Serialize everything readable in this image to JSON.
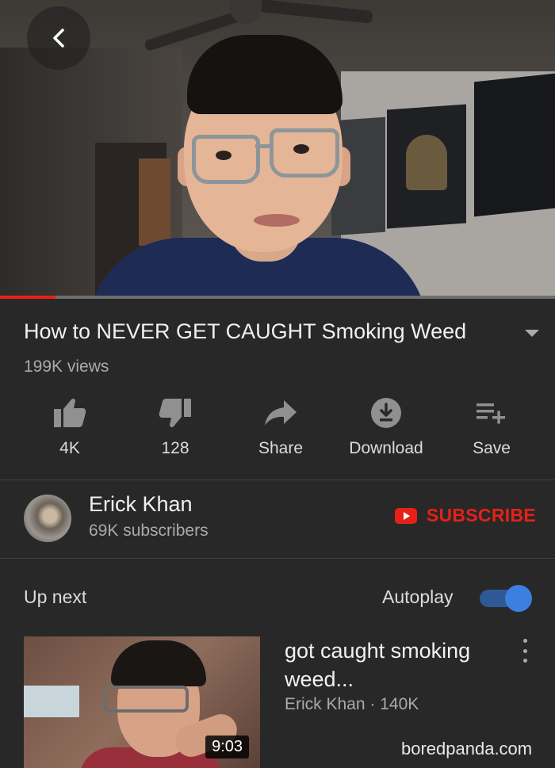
{
  "video": {
    "title": "How to NEVER GET CAUGHT Smoking Weed",
    "views": "199K views",
    "progress": 0.1
  },
  "actions": [
    {
      "icon": "thumbs-up-icon",
      "label": "4K"
    },
    {
      "icon": "thumbs-down-icon",
      "label": "128"
    },
    {
      "icon": "share-icon",
      "label": "Share"
    },
    {
      "icon": "download-icon",
      "label": "Download"
    },
    {
      "icon": "playlist-add-icon",
      "label": "Save"
    }
  ],
  "channel": {
    "name": "Erick Khan",
    "subscribers": "69K subscribers",
    "subscribe_label": "SUBSCRIBE"
  },
  "up_next": {
    "heading": "Up next",
    "autoplay_label": "Autoplay",
    "autoplay_on": true
  },
  "recommendation": {
    "title": "got caught smoking weed...",
    "meta": "Erick Khan · 140K",
    "duration": "9:03"
  },
  "watermark": "boredpanda.com",
  "colors": {
    "background": "#282828",
    "accent_red": "#e62117",
    "toggle_blue": "#3d7fe0"
  }
}
